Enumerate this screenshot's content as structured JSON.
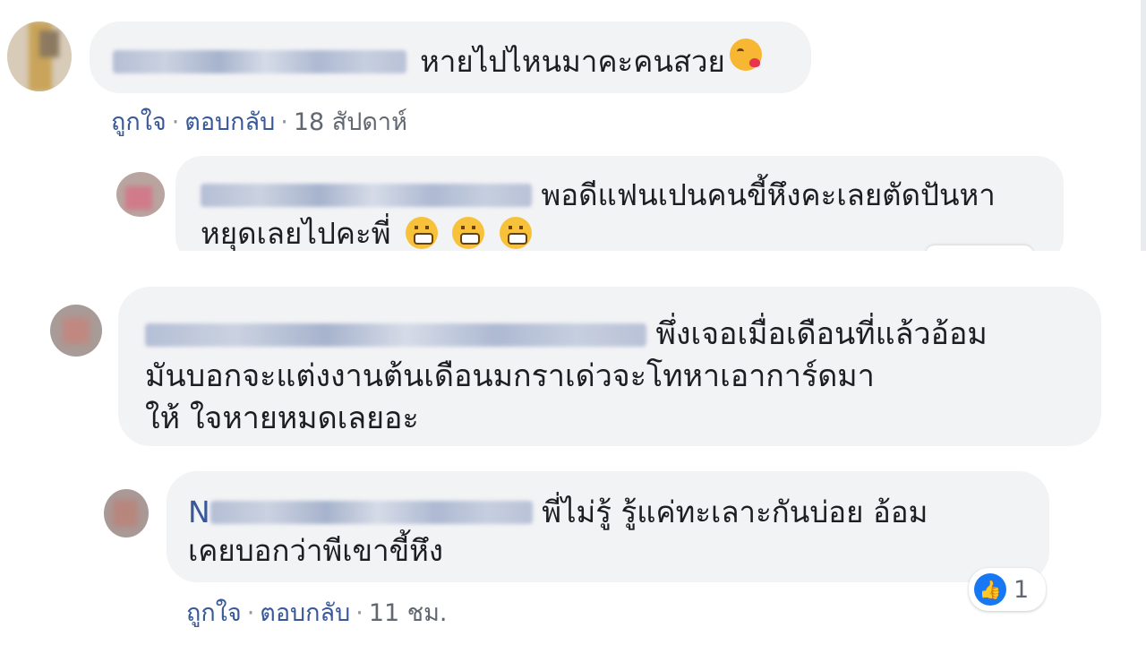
{
  "comments": [
    {
      "text": "หายไปไหนมาคะคนสวย",
      "meta": {
        "like": "ถูกใจ",
        "reply": "ตอบกลับ",
        "time": "18 สัปดาห์"
      }
    },
    {
      "text_line1": "พอดีแฟนเปนคนขี้หึงคะเลยตัดปันหา",
      "text_line2": "หยุดเลยไปคะพี่"
    },
    {
      "text_line1": "พึ่งเจอเมื่อเดือนที่แล้วอ้อม",
      "text_line2": "มันบอกจะแต่งงานต้นเดือนมกราเด่วจะโทหาเอาการ์ดมา",
      "text_line3": "ให้ ใจหายหมดเลยอะ"
    },
    {
      "name_initial": "N",
      "text_line1": "พี่ไม่รู้ รู้แค่ทะเลาะกันบ่อย อ้อม",
      "text_line2": "เคยบอกว่าพีเขาขี้หึง",
      "meta": {
        "like": "ถูกใจ",
        "reply": "ตอบกลับ",
        "time": "11 ชม."
      },
      "reaction_count": "1"
    }
  ],
  "meta_separator": "·",
  "icons": [
    "kiss-emoji-icon",
    "grimace-emoji-icon",
    "like-icon"
  ],
  "colors": {
    "bubble": "#f2f3f5",
    "link": "#385898",
    "like": "#1877f2"
  }
}
